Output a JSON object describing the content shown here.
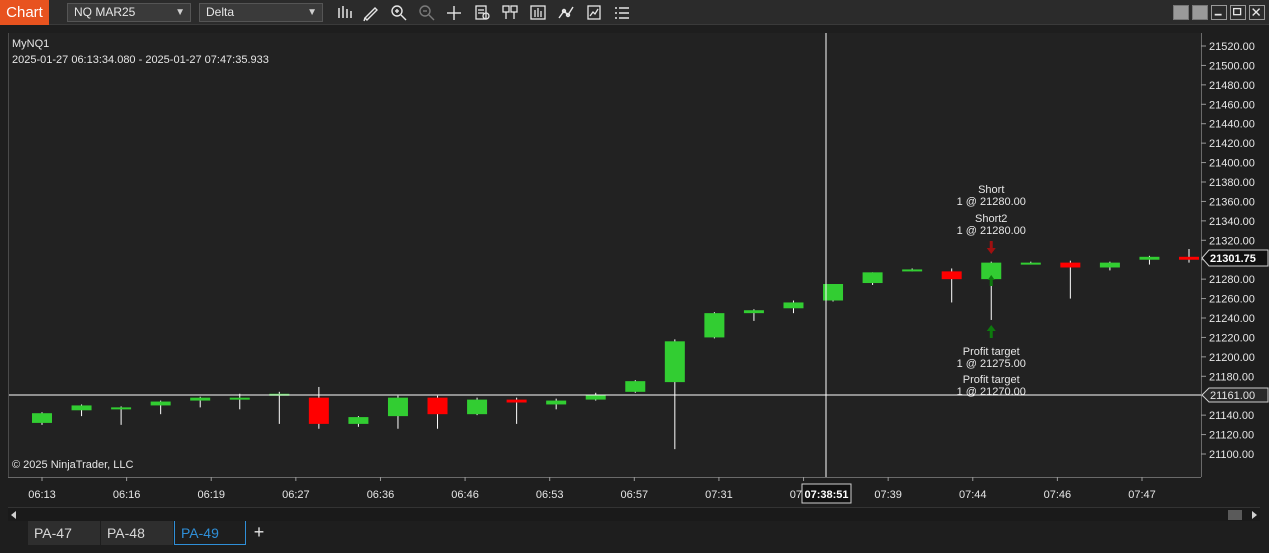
{
  "window": {
    "title": "Chart",
    "instrument": "NQ MAR25",
    "bar_type": "Delta"
  },
  "toolbar_icons": [
    "bar-type-icon",
    "drawing-tool-icon",
    "zoom-in-icon",
    "zoom-out-icon",
    "crosshair-icon",
    "data-box-icon",
    "templates-icon",
    "chart-trader-icon",
    "indicators-icon",
    "strategies-icon",
    "properties-icon"
  ],
  "chart": {
    "instrument_label": "MyNQ1",
    "date_range": "2025-01-27 06:13:34.080 - 2025-01-27 07:47:35.933",
    "copyright": "© 2025 NinjaTrader, LLC",
    "last_price_label": "21301.75",
    "crosshair_price_label": "21161.00",
    "crosshair_time_label": "07:38:51",
    "colors": {
      "up": "#32cd32",
      "down": "#ff0000",
      "background": "#222222",
      "crosshair": "#ffffff",
      "entry_marker": "#a01010",
      "exit_marker": "#0e7a0e"
    },
    "executions": [
      {
        "name": "Short",
        "detail": "1 @ 21280.00"
      },
      {
        "name": "Short2",
        "detail": "1 @ 21280.00"
      },
      {
        "name": "Profit target",
        "detail": "1 @ 21275.00"
      },
      {
        "name": "Profit target",
        "detail": "1 @ 21270.00"
      }
    ]
  },
  "chart_data": {
    "type": "candlestick",
    "title": "",
    "y_ticks": [
      "21520.00",
      "21500.00",
      "21480.00",
      "21460.00",
      "21440.00",
      "21420.00",
      "21400.00",
      "21380.00",
      "21360.00",
      "21340.00",
      "21320.00",
      "21300.00",
      "21280.00",
      "21260.00",
      "21240.00",
      "21220.00",
      "21200.00",
      "21180.00",
      "21160.00",
      "21140.00",
      "21120.00",
      "21100.00"
    ],
    "ylim": [
      21090,
      21527
    ],
    "x_ticks": [
      "06:13",
      "06:16",
      "06:19",
      "06:27",
      "06:36",
      "06:46",
      "06:53",
      "06:57",
      "07:31",
      "07:31",
      "07:39",
      "07:44",
      "07:46",
      "07:47"
    ],
    "candles": [
      {
        "open": 21132,
        "high": 21143,
        "low": 21130,
        "close": 21142
      },
      {
        "open": 21145,
        "high": 21151,
        "low": 21139,
        "close": 21150
      },
      {
        "open": 21148,
        "high": 21149,
        "low": 21130,
        "close": 21148
      },
      {
        "open": 21150,
        "high": 21155,
        "low": 21141,
        "close": 21154
      },
      {
        "open": 21155,
        "high": 21159,
        "low": 21148,
        "close": 21158
      },
      {
        "open": 21158,
        "high": 21162,
        "low": 21146,
        "close": 21158
      },
      {
        "open": 21161,
        "high": 21164,
        "low": 21131,
        "close": 21162
      },
      {
        "open": 21158,
        "high": 21169,
        "low": 21126,
        "close": 21131
      },
      {
        "open": 21131,
        "high": 21139,
        "low": 21128,
        "close": 21138
      },
      {
        "open": 21139,
        "high": 21160,
        "low": 21126,
        "close": 21158
      },
      {
        "open": 21158,
        "high": 21160,
        "low": 21126,
        "close": 21141
      },
      {
        "open": 21141,
        "high": 21158,
        "low": 21140,
        "close": 21156
      },
      {
        "open": 21156,
        "high": 21158,
        "low": 21131,
        "close": 21153
      },
      {
        "open": 21151,
        "high": 21157,
        "low": 21146,
        "close": 21155
      },
      {
        "open": 21156,
        "high": 21163,
        "low": 21155,
        "close": 21161
      },
      {
        "open": 21164,
        "high": 21176,
        "low": 21163,
        "close": 21175
      },
      {
        "open": 21174,
        "high": 21218,
        "low": 21105,
        "close": 21216
      },
      {
        "open": 21220,
        "high": 21246,
        "low": 21219,
        "close": 21245
      },
      {
        "open": 21245,
        "high": 21249,
        "low": 21237,
        "close": 21248
      },
      {
        "open": 21250,
        "high": 21258,
        "low": 21245,
        "close": 21256
      },
      {
        "open": 21258,
        "high": 21275,
        "low": 21257,
        "close": 21275
      },
      {
        "open": 21276,
        "high": 21287,
        "low": 21274,
        "close": 21287
      },
      {
        "open": 21289,
        "high": 21291,
        "low": 21288,
        "close": 21290
      },
      {
        "open": 21288,
        "high": 21291,
        "low": 21256,
        "close": 21280
      },
      {
        "open": 21280,
        "high": 21298,
        "low": 21238,
        "close": 21297
      },
      {
        "open": 21297,
        "high": 21298,
        "low": 21296,
        "close": 21297
      },
      {
        "open": 21297,
        "high": 21299,
        "low": 21260,
        "close": 21292
      },
      {
        "open": 21292,
        "high": 21298,
        "low": 21289,
        "close": 21297
      },
      {
        "open": 21300,
        "high": 21304,
        "low": 21295,
        "close": 21303
      },
      {
        "open": 21303,
        "high": 21311,
        "low": 21297,
        "close": 21300
      }
    ]
  },
  "tabs": [
    {
      "label": "PA-47",
      "active": false
    },
    {
      "label": "PA-48",
      "active": false
    },
    {
      "label": "PA-49",
      "active": true
    }
  ],
  "add_tab_label": "+"
}
